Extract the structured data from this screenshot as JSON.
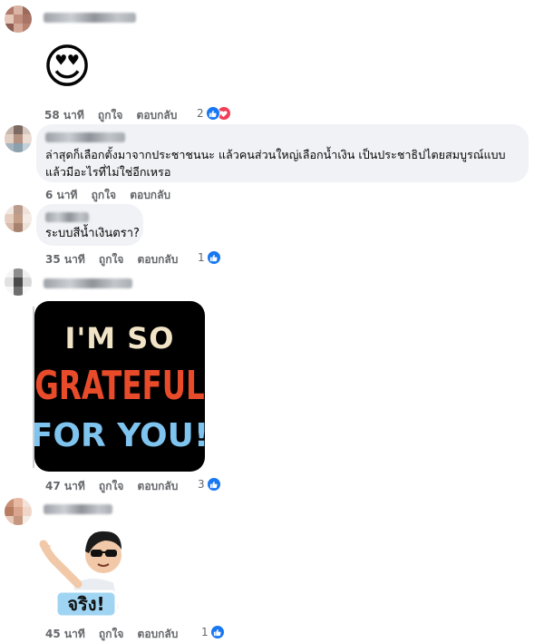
{
  "comments": [
    {
      "emoji": "😍",
      "meta": {
        "time": "58 นาที",
        "like": "ถูกใจ",
        "reply": "ตอบกลับ"
      },
      "reaction_count": "2",
      "reactions": [
        "like-icon",
        "love-icon"
      ]
    },
    {
      "text_line1": "ล่าสุดก็เลือกตั้งมาจากประชาชนนะ แล้วคนส่วนใหญ่เลือกน้ำเงิน เป็นประชาธิปไตยสมบูรณ์แบบ",
      "text_line2": "แล้วมีอะไรที่ไม่ใช่อีกเหรอ",
      "meta": {
        "time": "6 นาที",
        "like": "ถูกใจ",
        "reply": "ตอบกลับ"
      }
    },
    {
      "text": "ระบบสีน้ำเงินตรา?",
      "meta": {
        "time": "35 นาที",
        "like": "ถูกใจ",
        "reply": "ตอบกลับ"
      },
      "reaction_count": "1",
      "reactions": [
        "like-icon"
      ]
    },
    {
      "sticker_lines": [
        "I'M SO",
        "GRATEFUL",
        "FOR YOU!"
      ],
      "meta": {
        "time": "47 นาที",
        "like": "ถูกใจ",
        "reply": "ตอบกลับ"
      },
      "reaction_count": "3",
      "reactions": [
        "like-icon"
      ]
    },
    {
      "sticker_caption": "จริง!",
      "meta": {
        "time": "45 นาที",
        "like": "ถูกใจ",
        "reply": "ตอบกลับ"
      },
      "reaction_count": "1",
      "reactions": [
        "like-icon"
      ]
    }
  ],
  "colors": {
    "like": "#1877f2",
    "love": "#f33e58",
    "meta": "#65676b",
    "bubble": "#f0f2f5"
  }
}
